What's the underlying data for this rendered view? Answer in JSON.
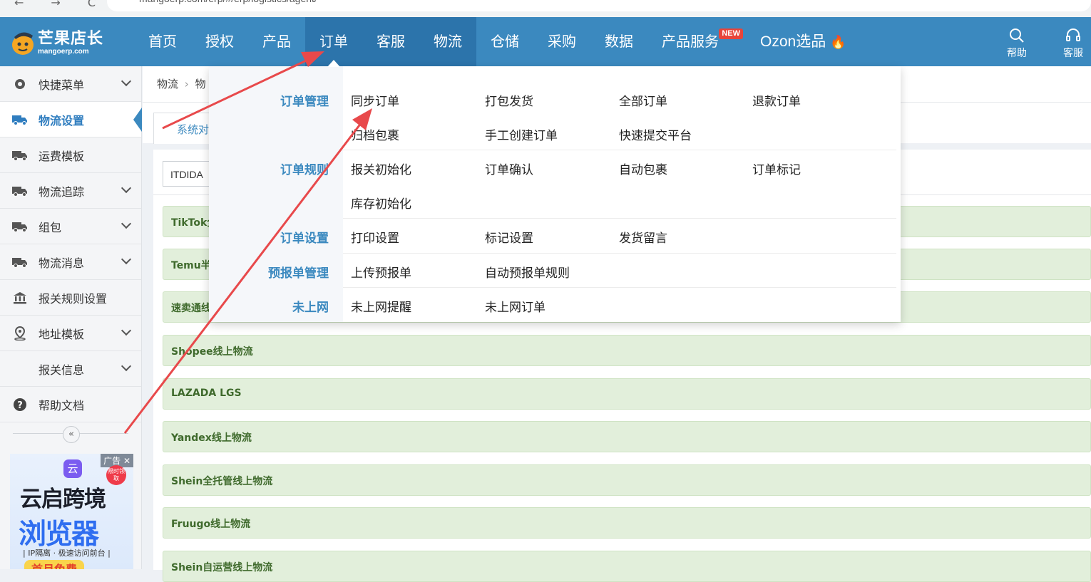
{
  "browser": {
    "url": "mangoerp.com/erp/#/erp/logistics/agent/"
  },
  "brand": {
    "name": "芒果店长",
    "domain": "mangoerp.com"
  },
  "topnav": {
    "items": [
      {
        "label": "首页"
      },
      {
        "label": "授权"
      },
      {
        "label": "产品"
      },
      {
        "label": "订单"
      },
      {
        "label": "客服"
      },
      {
        "label": "物流"
      },
      {
        "label": "仓储"
      },
      {
        "label": "采购"
      },
      {
        "label": "数据"
      },
      {
        "label": "产品服务",
        "badge": "NEW"
      },
      {
        "label": "Ozon选品"
      }
    ],
    "help_label": "帮助",
    "service_label": "客服"
  },
  "sidebar": {
    "items": [
      {
        "label": "快捷菜单",
        "icon": "gear-icon"
      },
      {
        "label": "物流设置",
        "icon": "truck-icon"
      },
      {
        "label": "运费模板",
        "icon": "truck-icon"
      },
      {
        "label": "物流追踪",
        "icon": "truck-icon"
      },
      {
        "label": "组包",
        "icon": "truck-icon"
      },
      {
        "label": "物流消息",
        "icon": "truck-icon"
      },
      {
        "label": "报关规则设置",
        "icon": "bank-icon"
      },
      {
        "label": "地址模板",
        "icon": "location-icon"
      },
      {
        "label": "报关信息",
        "icon": ""
      },
      {
        "label": "帮助文档",
        "icon": "question-icon"
      }
    ]
  },
  "ad": {
    "tag": "广告",
    "app_glyph": "云",
    "limited": "限时领取",
    "title1": "云启跨境",
    "title2": "浏览器",
    "subtitle": "| IP隔离 · 极速访问前台 |",
    "cta": "首月免费"
  },
  "breadcrumb": {
    "first": "物流",
    "second": "物"
  },
  "tab": {
    "label": "系统对"
  },
  "search": {
    "value": "ITDIDA"
  },
  "rows": [
    "TikTok全",
    "Temu半",
    "速卖通线",
    "Shopee线上物流",
    "LAZADA LGS",
    "Yandex线上物流",
    "Shein全托管线上物流",
    "Fruugo线上物流",
    "Shein自运营线上物流"
  ],
  "dropdown": {
    "groups": [
      {
        "title": "订单管理",
        "links": [
          "同步订单",
          "打包发货",
          "全部订单",
          "退款订单",
          "归档包裹",
          "手工创建订单",
          "快速提交平台"
        ]
      },
      {
        "title": "订单规则",
        "links": [
          "报关初始化",
          "订单确认",
          "自动包裹",
          "订单标记",
          "库存初始化"
        ]
      },
      {
        "title": "订单设置",
        "links": [
          "打印设置",
          "标记设置",
          "发货留言"
        ]
      },
      {
        "title": "预报单管理",
        "links": [
          "上传预报单",
          "自动预报单规则"
        ]
      },
      {
        "title": "未上网",
        "links": [
          "未上网提醒",
          "未上网订单"
        ]
      }
    ]
  },
  "colors": {
    "nav_bg": "#3b89bf",
    "accent": "#3b89bf",
    "row_bg": "#e2efdb",
    "row_text": "#3f6a2c",
    "arrow": "#e8494b"
  }
}
